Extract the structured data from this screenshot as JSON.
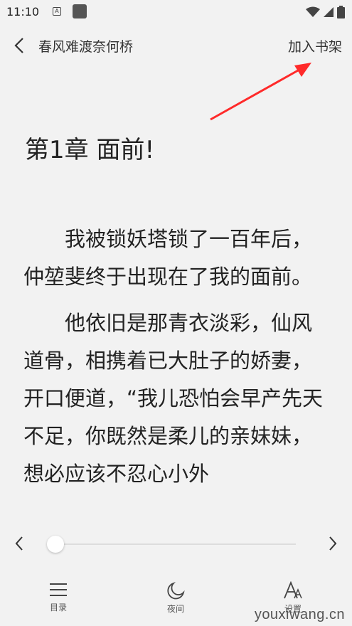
{
  "status_bar": {
    "time": "11:10",
    "a_icon_text": "A"
  },
  "header": {
    "book_title": "春风难渡奈何桥",
    "add_to_shelf": "加入书架"
  },
  "chapter": {
    "title": "第1章 面前!",
    "paragraphs": [
      "我被锁妖塔锁了一百年后，仲堃斐终于出现在了我的面前。",
      "他依旧是那青衣淡彩，仙风道骨，相携着已大肚子的娇妻，开口便道，“我儿恐怕会早产先天不足，你既然是柔儿的亲妹妹，想必应该不忍心小外"
    ]
  },
  "progress": {
    "value": 0
  },
  "bottom_nav": {
    "toc_label": "目录",
    "night_label": "夜间",
    "settings_label": "设置"
  },
  "watermark": "youxiwang.cn",
  "colors": {
    "background": "#f2f2f2",
    "text": "#222222",
    "annotation_arrow": "#ff2a2a"
  }
}
